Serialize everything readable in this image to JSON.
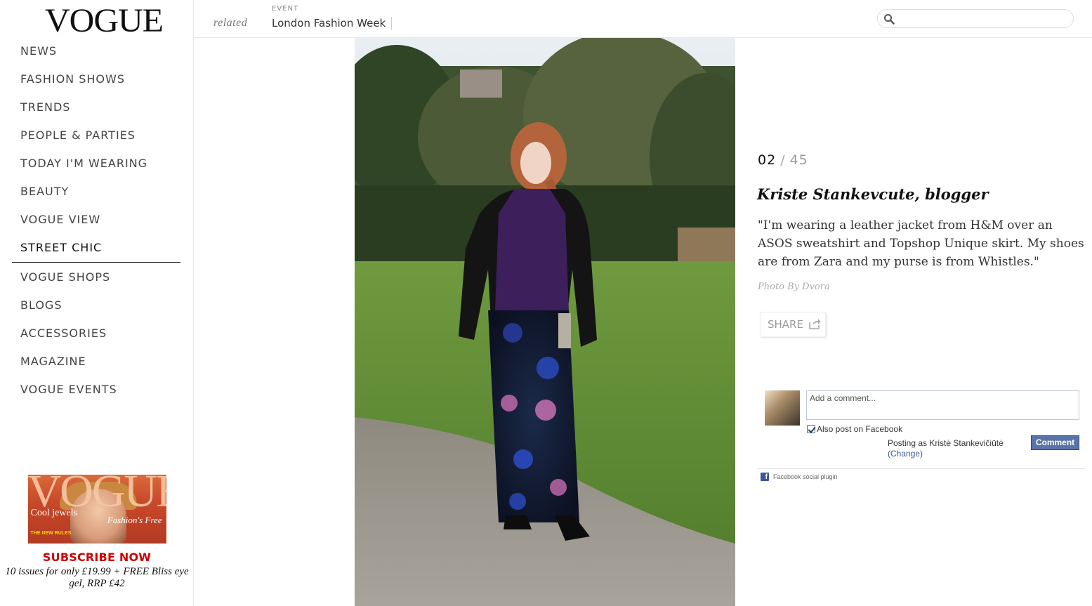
{
  "sidebar": {
    "logo": "VOGUE",
    "items": [
      {
        "label": "NEWS"
      },
      {
        "label": "FASHION SHOWS"
      },
      {
        "label": "TRENDS"
      },
      {
        "label": "PEOPLE & PARTIES"
      },
      {
        "label": "TODAY I'M WEARING"
      },
      {
        "label": "BEAUTY"
      },
      {
        "label": "VOGUE VIEW"
      },
      {
        "label": "STREET CHIC"
      },
      {
        "label": "VOGUE SHOPS"
      },
      {
        "label": "BLOGS"
      },
      {
        "label": "ACCESSORIES"
      },
      {
        "label": "MAGAZINE"
      },
      {
        "label": "VOGUE EVENTS"
      }
    ],
    "active_item": "STREET CHIC",
    "promo": {
      "cover_masthead": "VOGUE",
      "cover_line_1": "Cool jewels",
      "cover_line_2": "Fashion's Free",
      "cover_line_3": "THE NEW RULES",
      "cta": "SUBSCRIBE NOW",
      "text": "10 issues for only £19.99 + FREE Bliss eye gel, RRP £42"
    }
  },
  "topbar": {
    "related_label": "related",
    "event_label": "EVENT",
    "event_link": "London Fashion Week",
    "search_placeholder": ""
  },
  "gallery": {
    "current": "02",
    "separator": "/",
    "total": "45",
    "title": "Kriste Stankevcute, blogger",
    "quote": "\"I'm wearing a leather jacket from H&M over an ASOS sweatshirt and Topshop Unique skirt. My shoes are from Zara and my purse is from Whistles.\"",
    "credit": "Photo By Dvora",
    "share_label": "SHARE"
  },
  "comments": {
    "placeholder": "Add a comment...",
    "also_post": "Also post on Facebook",
    "also_post_checked": true,
    "posting_as": "Posting as Kristė Stankevičiūtė",
    "change": "(Change)",
    "button": "Comment",
    "plugin": "Facebook social plugin"
  },
  "colors": {
    "subscribe": "#cc0000",
    "fb_button": "#5b74a8",
    "fb_link": "#3b5998"
  }
}
